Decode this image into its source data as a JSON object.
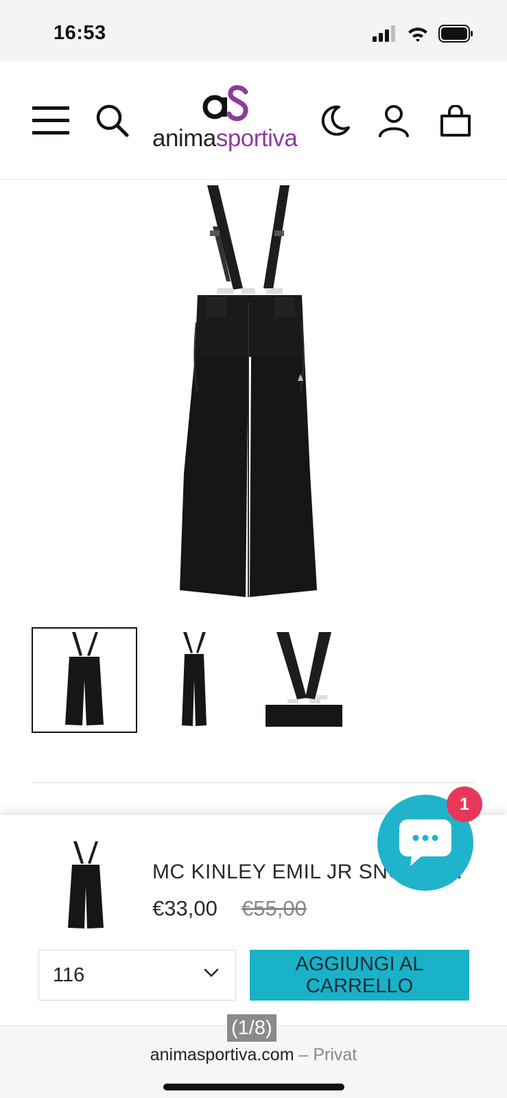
{
  "status_bar": {
    "time": "16:53"
  },
  "header": {
    "logo_part1": "anima",
    "logo_part2": "sportiva",
    "logo_mark": "aS",
    "icons": [
      "menu-icon",
      "search-icon",
      "moon-icon",
      "user-icon",
      "bag-icon"
    ]
  },
  "gallery": {
    "thumbnails": [
      "front-view",
      "side-view",
      "suspender-detail"
    ],
    "active_index": 0
  },
  "sticky_cart": {
    "product_title": "MC KINLEY EMIL JR SNOW PANT",
    "price_now": "€33,00",
    "price_old": "€55,00",
    "size_selected": "116",
    "add_to_cart_label": "AGGIUNGI AL CARRELLO"
  },
  "chat": {
    "badge_count": "1"
  },
  "browser": {
    "image_counter": "(1/8)",
    "host": "animasportiva.com",
    "separator": " – ",
    "mode": "Privat"
  },
  "colors": {
    "accent": "#19b2c8",
    "brand_purple": "#8e3a9e",
    "badge": "#e8385a"
  }
}
